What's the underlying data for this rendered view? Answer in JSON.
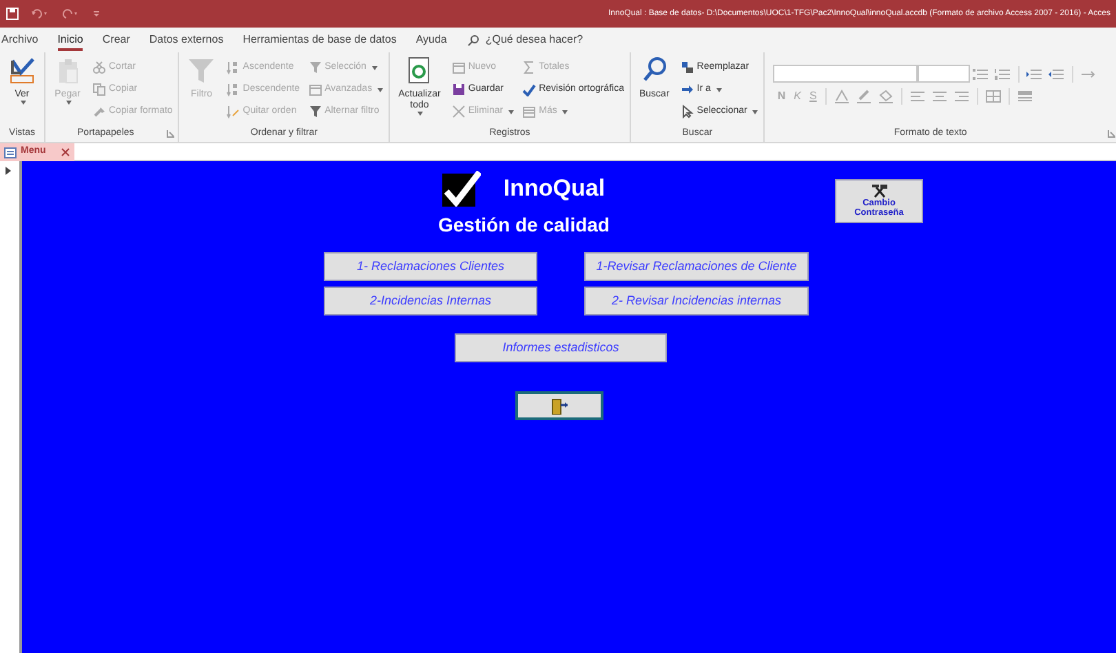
{
  "window": {
    "title": "InnoQual : Base de datos- D:\\Documentos\\UOC\\1-TFG\\Pac2\\InnoQual\\innoQual.accdb (Formato de archivo Access 2007 - 2016) -  Acces"
  },
  "ribbon_tabs": [
    {
      "label": "Archivo",
      "selected": false
    },
    {
      "label": "Inicio",
      "selected": true
    },
    {
      "label": "Crear",
      "selected": false
    },
    {
      "label": "Datos externos",
      "selected": false
    },
    {
      "label": "Herramientas de base de datos",
      "selected": false
    },
    {
      "label": "Ayuda",
      "selected": false
    }
  ],
  "tell_me": {
    "placeholder": "¿Qué desea hacer?"
  },
  "ribbon_groups": [
    {
      "label": "Vistas",
      "kind": "commands",
      "launcher": false,
      "columns": [
        [
          {
            "label": "Ver",
            "kind": "large",
            "disabled": false,
            "menu": true
          }
        ]
      ]
    },
    {
      "label": "Portapapeles",
      "kind": "commands",
      "launcher": true,
      "columns": [
        [
          {
            "label": "Pegar",
            "kind": "large",
            "disabled": true,
            "menu": true
          }
        ],
        [
          {
            "label": "Cortar",
            "kind": "small",
            "disabled": true,
            "menu": false
          },
          {
            "label": "Copiar",
            "kind": "small",
            "disabled": true,
            "menu": false
          },
          {
            "label": "Copiar formato",
            "kind": "small",
            "disabled": true,
            "menu": false
          }
        ]
      ]
    },
    {
      "label": "Ordenar y filtrar",
      "kind": "commands",
      "launcher": false,
      "columns": [
        [
          {
            "label": "Filtro",
            "kind": "large",
            "disabled": true,
            "menu": false
          }
        ],
        [
          {
            "label": "Ascendente",
            "kind": "small",
            "disabled": true,
            "menu": false
          },
          {
            "label": "Descendente",
            "kind": "small",
            "disabled": true,
            "menu": false
          },
          {
            "label": "Quitar orden",
            "kind": "small",
            "disabled": true,
            "menu": false
          }
        ],
        [
          {
            "label": "Selección",
            "kind": "small",
            "disabled": true,
            "menu": true
          },
          {
            "label": "Avanzadas",
            "kind": "small",
            "disabled": true,
            "menu": true
          },
          {
            "label": "Alternar filtro",
            "kind": "small",
            "disabled": true,
            "menu": false
          }
        ]
      ]
    },
    {
      "label": "Registros",
      "kind": "commands",
      "launcher": false,
      "columns": [
        [
          {
            "label": "Actualizar todo",
            "kind": "large",
            "disabled": false,
            "menu": true
          }
        ],
        [
          {
            "label": "Nuevo",
            "kind": "small",
            "disabled": true,
            "menu": false
          },
          {
            "label": "Guardar",
            "kind": "small",
            "disabled": false,
            "menu": false
          },
          {
            "label": "Eliminar",
            "kind": "small",
            "disabled": true,
            "menu": true
          }
        ],
        [
          {
            "label": "Totales",
            "kind": "small",
            "disabled": true,
            "menu": false
          },
          {
            "label": "Revisión ortográfica",
            "kind": "small",
            "disabled": false,
            "menu": false
          },
          {
            "label": "Más",
            "kind": "small",
            "disabled": true,
            "menu": true
          }
        ]
      ]
    },
    {
      "label": "Buscar",
      "kind": "commands",
      "launcher": false,
      "columns": [
        [
          {
            "label": "Buscar",
            "kind": "large",
            "disabled": false,
            "menu": false
          }
        ],
        [
          {
            "label": "Reemplazar",
            "kind": "small",
            "disabled": false,
            "menu": false
          },
          {
            "label": "Ir a",
            "kind": "small",
            "disabled": false,
            "menu": true
          },
          {
            "label": "Seleccionar",
            "kind": "small",
            "disabled": false,
            "menu": true
          }
        ]
      ]
    },
    {
      "label": "Formato de texto",
      "kind": "format",
      "launcher": true,
      "style_buttons": [
        "N",
        "K",
        "S"
      ]
    }
  ],
  "document_tabs": [
    {
      "label": "Menu",
      "selected": true
    }
  ],
  "form": {
    "title": "InnoQual",
    "subtitle": "Gestión de calidad",
    "password_button": {
      "label": "Cambio Contraseña"
    },
    "buttons": [
      {
        "label": "1- Reclamaciones Clientes"
      },
      {
        "label": "1-Revisar Reclamaciones de Cliente"
      },
      {
        "label": "2-Incidencias Internas"
      },
      {
        "label": "2- Revisar Incidencias internas"
      }
    ],
    "reports_button": {
      "label": "Informes estadisticos"
    },
    "exit_button": {
      "focused": true
    }
  }
}
